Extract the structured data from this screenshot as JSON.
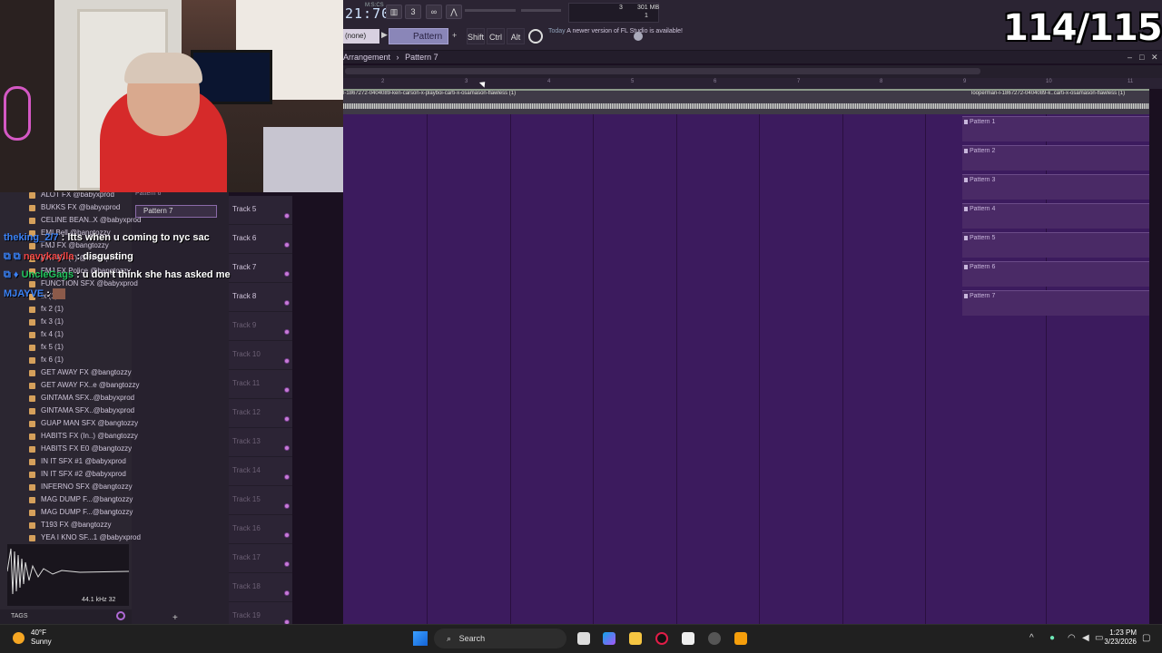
{
  "stream": {
    "counter": "114/115",
    "chat": [
      {
        "user": "theking_2/7",
        "sep": " : ",
        "msg": "ltts when u coming to nyc sac"
      },
      {
        "user": "navykaylla",
        "sep": " : ",
        "msg": "disgusting"
      },
      {
        "user": "UncleGags",
        "sep": " : ",
        "msg": "u don't think she has asked me"
      },
      {
        "user": "MJAYVE",
        "sep": " : ",
        "msg": ""
      }
    ]
  },
  "fl": {
    "time": "21:70",
    "msc": "M:S:CS",
    "cpu": "3",
    "memory": "301 MB",
    "memory2": "1",
    "pattern_selector": "(none)",
    "pattern_name": "Pattern 7",
    "modifiers": [
      "Shift",
      "Ctrl",
      "Alt"
    ],
    "notice_prefix": "Today",
    "notice_text": "A newer version of FL Studio is available!",
    "playlist_title": "Arrangement",
    "playlist_sep": "›",
    "playlist_pattern": "Pattern 7",
    "ruler": [
      "2",
      "3",
      "4",
      "5",
      "6",
      "7",
      "8",
      "9",
      "10",
      "11"
    ],
    "clip_left": "l-1867272-0404089-ken-carson-x-playboi-carti-x-osamason-flawless (1)",
    "clip_right": "looperman-l-1867272-0404089-k..carti-x-osamason-flawless (1)",
    "patterns": [
      "Pattern 1",
      "Pattern 2",
      "Pattern 3",
      "Pattern 4",
      "Pattern 5",
      "Pattern 6",
      "Pattern 7"
    ],
    "channel_pattern_prev": "Pattern 6",
    "channel_pattern_current": "Pattern 7",
    "tracks": [
      "Track 5",
      "Track 6",
      "Track 7",
      "Track 8",
      "Track 9",
      "Track 10",
      "Track 11",
      "Track 12",
      "Track 13",
      "Track 14",
      "Track 15",
      "Track 16",
      "Track 17",
      "Track 18",
      "Track 19"
    ],
    "browser": [
      "ALOT FX @babyxprod",
      "BUKKS FX @babyxprod",
      "CELINE BEAN..X @babyxprod",
      "EMI Bell @bangtozzy",
      "FMJ FX @bangtozzy",
      "FMJ FX (2) @babyxprod",
      "FMJ FX Police @bangtozzy",
      "FUNCTION SFX @babyxprod",
      "fx (1)",
      "fx 2 (1)",
      "fx 3 (1)",
      "fx 4 (1)",
      "fx 5 (1)",
      "fx 6 (1)",
      "GET AWAY FX @bangtozzy",
      "GET AWAY FX..e @bangtozzy",
      "GINTAMA SFX..@babyxprod",
      "GINTAMA SFX..@babyxprod",
      "GUAP MAN SFX @bangtozzy",
      "HABITS FX (In..) @bangtozzy",
      "HABITS FX E0 @bangtozzy",
      "IN IT SFX #1 @babyxprod",
      "IN IT SFX #2 @babyxprod",
      "INFERNO SFX @bangtozzy",
      "MAG DUMP F...@bangtozzy",
      "MAG DUMP F...@bangtozzy",
      "T193 FX @bangtozzy",
      "YEA I KNO SF...1 @babyxprod"
    ],
    "sample_rate": "44.1 kHz 32",
    "tags_label": "TAGS"
  },
  "taskbar": {
    "temp": "40°F",
    "condition": "Sunny",
    "search_label": "Search",
    "time": "1:23 PM",
    "date": "3/23/2026"
  }
}
